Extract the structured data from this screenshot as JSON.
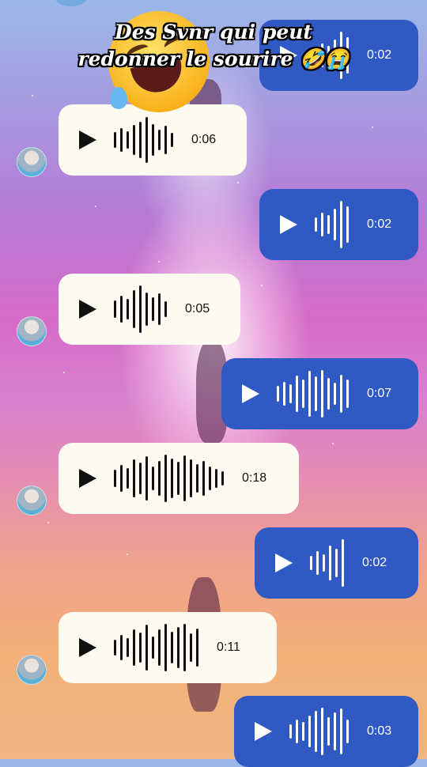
{
  "caption": {
    "line1": "Des Svnr qui peut",
    "line2": "redonner le sourire 🤣😭"
  },
  "messages": [
    {
      "type": "sent",
      "duration": "0:02"
    },
    {
      "type": "received",
      "duration": "0:06"
    },
    {
      "type": "sent",
      "duration": "0:02"
    },
    {
      "type": "received",
      "duration": "0:05"
    },
    {
      "type": "sent",
      "duration": "0:07"
    },
    {
      "type": "received",
      "duration": "0:18"
    },
    {
      "type": "sent",
      "duration": "0:02"
    },
    {
      "type": "received",
      "duration": "0:11"
    },
    {
      "type": "sent",
      "duration": "0:03"
    }
  ],
  "icons": {
    "play": "play-icon",
    "waveform": "waveform-icon",
    "avatar": "avatar",
    "emoji": "rolling-laughing-emoji"
  },
  "colors": {
    "sent_bubble": "#3159c4",
    "received_bubble": "#fdfbef"
  }
}
